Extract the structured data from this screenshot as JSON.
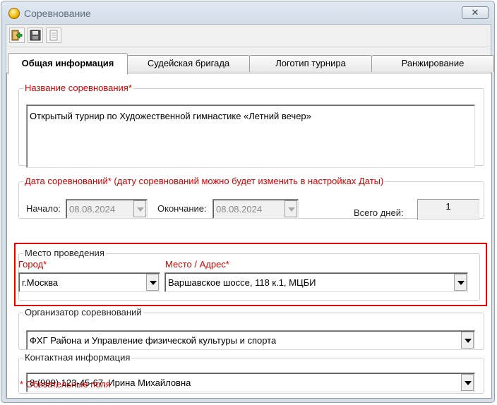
{
  "window": {
    "title": "Соревнование"
  },
  "toolbar": {
    "buttons": [
      "exit-icon",
      "save-icon",
      "document-icon"
    ]
  },
  "tabs": [
    {
      "label": "Общая информация",
      "active": true
    },
    {
      "label": "Судейская бригада",
      "active": false
    },
    {
      "label": "Логотип турнира",
      "active": false
    },
    {
      "label": "Ранжирование",
      "active": false
    }
  ],
  "competition_name": {
    "legend": "Название соревнования*",
    "value": "Открытый турнир по Художественной гимнастике «Летний вечер»"
  },
  "dates": {
    "legend": "Дата соревнований* (дату соревнований можно будет изменить в настройках Даты)",
    "start_label": "Начало:",
    "start_value": "08.08.2024",
    "end_label": "Окончание:",
    "end_value": "08.08.2024",
    "total_label": "Всего дней:",
    "total_value": "1"
  },
  "venue": {
    "legend": "Место проведения",
    "city_label": "Город*",
    "city_value": "г.Москва",
    "address_label": "Место / Адрес*",
    "address_value": "Варшавское шоссе, 118  к.1, МЦБИ"
  },
  "organizer": {
    "legend": "Организатор соревнований",
    "value": "ФХГ Района и Управление физической культуры и спорта"
  },
  "contact": {
    "legend": "Контактная информация",
    "value": "8 (999) 123-45-67, Ирина Михайловна"
  },
  "required_note": "* Обязательные поля",
  "colors": {
    "required": "#d40000",
    "highlight": "#e00000"
  }
}
